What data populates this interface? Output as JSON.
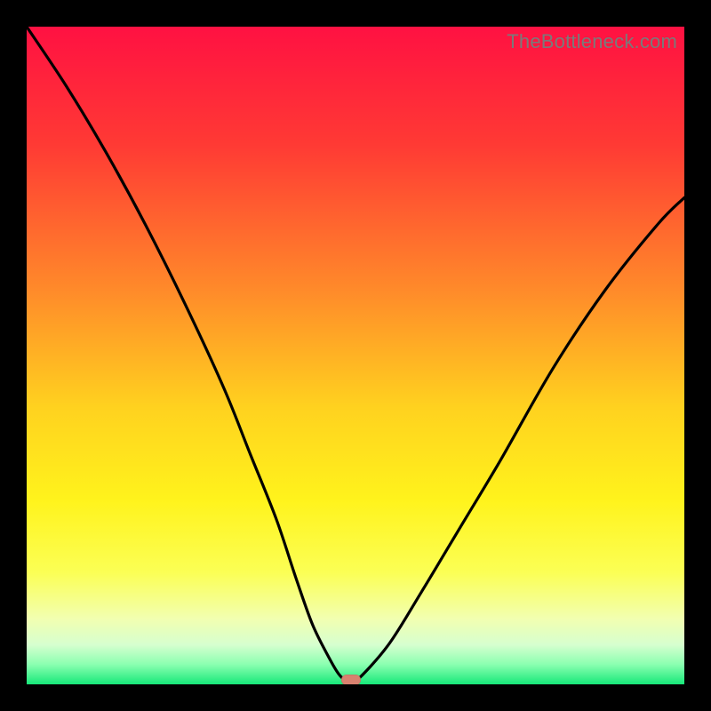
{
  "watermark": "TheBottleneck.com",
  "colors": {
    "frame": "#000000",
    "curve": "#000000",
    "marker": "#d8816f",
    "gradient_stops": [
      {
        "pct": 0,
        "color": "#ff1142"
      },
      {
        "pct": 18,
        "color": "#ff3a34"
      },
      {
        "pct": 40,
        "color": "#ff8a2a"
      },
      {
        "pct": 58,
        "color": "#ffd21f"
      },
      {
        "pct": 72,
        "color": "#fff31c"
      },
      {
        "pct": 83,
        "color": "#fbff55"
      },
      {
        "pct": 90,
        "color": "#f2ffb0"
      },
      {
        "pct": 94,
        "color": "#d6ffcf"
      },
      {
        "pct": 97,
        "color": "#8affb0"
      },
      {
        "pct": 100,
        "color": "#17e879"
      }
    ]
  },
  "chart_data": {
    "type": "line",
    "title": "",
    "xlabel": "",
    "ylabel": "",
    "xlim": [
      0,
      100
    ],
    "ylim": [
      0,
      100
    ],
    "legend": false,
    "grid": false,
    "annotations": [
      {
        "text": "TheBottleneck.com",
        "pos": "top-right"
      }
    ],
    "series": [
      {
        "name": "bottleneck-curve",
        "x": [
          0,
          6,
          12,
          18,
          24,
          30,
          34,
          38,
          41,
          43.5,
          46,
          47.5,
          48.8,
          50,
          55,
          60,
          66,
          72,
          80,
          88,
          96,
          100
        ],
        "y": [
          100,
          91,
          81,
          70,
          58,
          45,
          35,
          25,
          16,
          9,
          4,
          1.5,
          0.4,
          0.4,
          6,
          14,
          24,
          34,
          48,
          60,
          70,
          74
        ]
      }
    ],
    "marker": {
      "x": 49.3,
      "y": 0.7
    }
  }
}
